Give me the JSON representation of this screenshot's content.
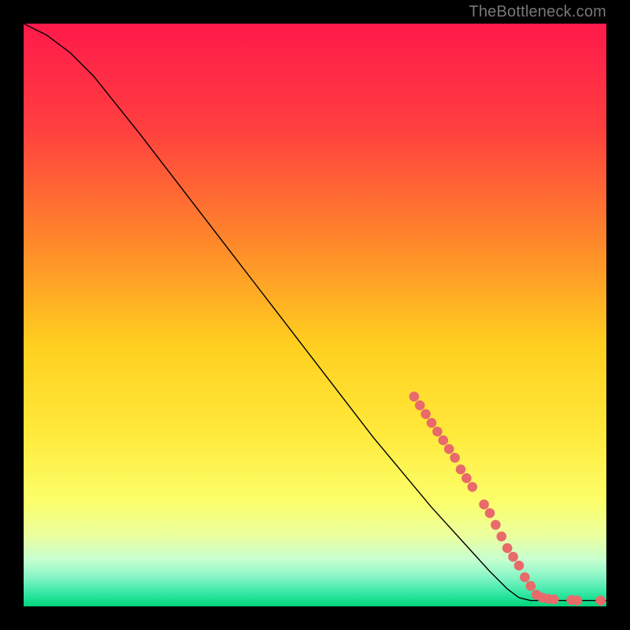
{
  "watermark": "TheBottleneck.com",
  "chart_data": {
    "type": "line",
    "xlim": [
      0,
      100
    ],
    "ylim": [
      0,
      100
    ],
    "curve": [
      {
        "x": 0,
        "y": 100
      },
      {
        "x": 4,
        "y": 98
      },
      {
        "x": 8,
        "y": 95
      },
      {
        "x": 12,
        "y": 91
      },
      {
        "x": 16,
        "y": 86
      },
      {
        "x": 20,
        "y": 81
      },
      {
        "x": 25,
        "y": 74.5
      },
      {
        "x": 30,
        "y": 68
      },
      {
        "x": 35,
        "y": 61.5
      },
      {
        "x": 40,
        "y": 55
      },
      {
        "x": 45,
        "y": 48.5
      },
      {
        "x": 50,
        "y": 42
      },
      {
        "x": 55,
        "y": 35.5
      },
      {
        "x": 60,
        "y": 29
      },
      {
        "x": 65,
        "y": 23
      },
      {
        "x": 70,
        "y": 17
      },
      {
        "x": 75,
        "y": 11.5
      },
      {
        "x": 80,
        "y": 6
      },
      {
        "x": 83,
        "y": 3
      },
      {
        "x": 85,
        "y": 1.5
      },
      {
        "x": 87,
        "y": 1
      },
      {
        "x": 90,
        "y": 1
      },
      {
        "x": 95,
        "y": 1
      },
      {
        "x": 100,
        "y": 1
      }
    ],
    "markers": [
      {
        "x": 67,
        "y": 36
      },
      {
        "x": 68,
        "y": 34.5
      },
      {
        "x": 69,
        "y": 33
      },
      {
        "x": 70,
        "y": 31.5
      },
      {
        "x": 71,
        "y": 30
      },
      {
        "x": 72,
        "y": 28.5
      },
      {
        "x": 73,
        "y": 27
      },
      {
        "x": 74,
        "y": 25.5
      },
      {
        "x": 75,
        "y": 23.5
      },
      {
        "x": 76,
        "y": 22
      },
      {
        "x": 77,
        "y": 20.5
      },
      {
        "x": 79,
        "y": 17.5
      },
      {
        "x": 80,
        "y": 16
      },
      {
        "x": 81,
        "y": 14
      },
      {
        "x": 82,
        "y": 12
      },
      {
        "x": 83,
        "y": 10
      },
      {
        "x": 84,
        "y": 8.5
      },
      {
        "x": 85,
        "y": 7
      },
      {
        "x": 86,
        "y": 5
      },
      {
        "x": 87,
        "y": 3.5
      },
      {
        "x": 88,
        "y": 2
      },
      {
        "x": 89,
        "y": 1.5
      },
      {
        "x": 90,
        "y": 1.3
      },
      {
        "x": 91,
        "y": 1.2
      },
      {
        "x": 94,
        "y": 1.1
      },
      {
        "x": 95,
        "y": 1
      },
      {
        "x": 99,
        "y": 1
      }
    ],
    "gradient_stops": [
      {
        "offset": 0,
        "color": "#ff1a4b"
      },
      {
        "offset": 18,
        "color": "#ff3f3f"
      },
      {
        "offset": 38,
        "color": "#ff8a2a"
      },
      {
        "offset": 55,
        "color": "#ffcf1f"
      },
      {
        "offset": 70,
        "color": "#ffe93a"
      },
      {
        "offset": 82,
        "color": "#fcff6a"
      },
      {
        "offset": 88,
        "color": "#eaffa0"
      },
      {
        "offset": 92,
        "color": "#c6ffd0"
      },
      {
        "offset": 95,
        "color": "#86f5c6"
      },
      {
        "offset": 98,
        "color": "#2de6a0"
      },
      {
        "offset": 100,
        "color": "#00d47a"
      }
    ],
    "marker_color": "#e96a6a",
    "curve_color": "#000000"
  }
}
